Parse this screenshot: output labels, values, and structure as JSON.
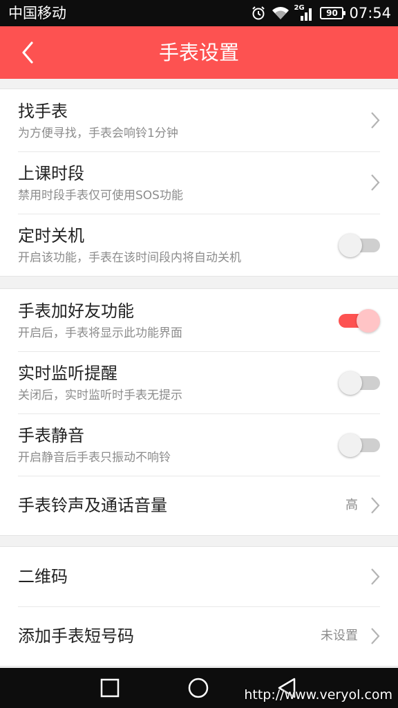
{
  "status_bar": {
    "carrier": "中国移动",
    "network": "2G",
    "battery": "90",
    "time": "07:54",
    "icons": [
      "alarm-icon",
      "wifi-icon",
      "signal-icon",
      "battery-icon"
    ]
  },
  "header": {
    "title": "手表设置",
    "back_icon": "chevron-left-icon",
    "color": "#fd5251"
  },
  "groups": [
    {
      "items": [
        {
          "title": "找手表",
          "subtitle": "为方便寻找，手表会响铃1分钟",
          "control": "chevron"
        },
        {
          "title": "上课时段",
          "subtitle": "禁用时段手表仅可使用SOS功能",
          "control": "chevron"
        },
        {
          "title": "定时关机",
          "subtitle": "开启该功能，手表在该时间段内将自动关机",
          "control": "toggle",
          "on": false
        }
      ]
    },
    {
      "items": [
        {
          "title": "手表加好友功能",
          "subtitle": "开启后，手表将显示此功能界面",
          "control": "toggle",
          "on": true
        },
        {
          "title": "实时监听提醒",
          "subtitle": "关闭后，实时监听时手表无提示",
          "control": "toggle",
          "on": false
        },
        {
          "title": "手表静音",
          "subtitle": "开启静音后手表只振动不响铃",
          "control": "toggle",
          "on": false
        },
        {
          "title": "手表铃声及通话音量",
          "value": "高",
          "control": "chevron"
        }
      ]
    },
    {
      "items": [
        {
          "title": "二维码",
          "control": "chevron"
        },
        {
          "title": "添加手表短号码",
          "value": "未设置",
          "control": "chevron"
        }
      ]
    }
  ],
  "nav_bar": {
    "icons": [
      "recent-apps-icon",
      "home-icon",
      "back-triangle-icon"
    ],
    "watermark": "http://www.veryol.com"
  }
}
